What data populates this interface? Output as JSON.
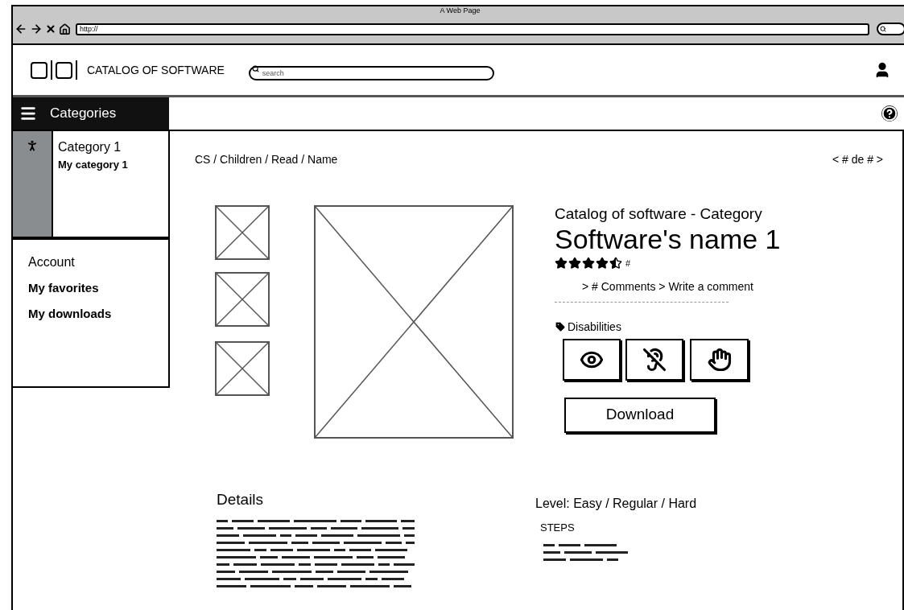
{
  "browser": {
    "title": "A Web Page",
    "url": "http://"
  },
  "header": {
    "title": "CATALOG OF SOFTWARE",
    "search": {
      "placeholder": "search"
    }
  },
  "menu": {
    "label": "Categories"
  },
  "sidebar": {
    "category": {
      "title": "Category 1",
      "item": "My category 1"
    },
    "account": {
      "title": "Account",
      "items": [
        "My favorites",
        "My downloads"
      ]
    }
  },
  "breadcrumb": "CS / Children / Read / Name",
  "pager": "< # de # >",
  "product": {
    "subtitle": "Catalog of software - Category",
    "name": "Software's name 1",
    "stars": 4.5,
    "rating_count": "#",
    "links": "> # Comments > Write a comment",
    "disabilities_label": "Disabilities",
    "disabilities": [
      {
        "kind": "visual"
      },
      {
        "kind": "hearing"
      },
      {
        "kind": "motor"
      }
    ],
    "download": "Download"
  },
  "details": {
    "title": "Details"
  },
  "level": "Level: Easy / Regular / Hard",
  "steps": {
    "title": "STEPS"
  }
}
